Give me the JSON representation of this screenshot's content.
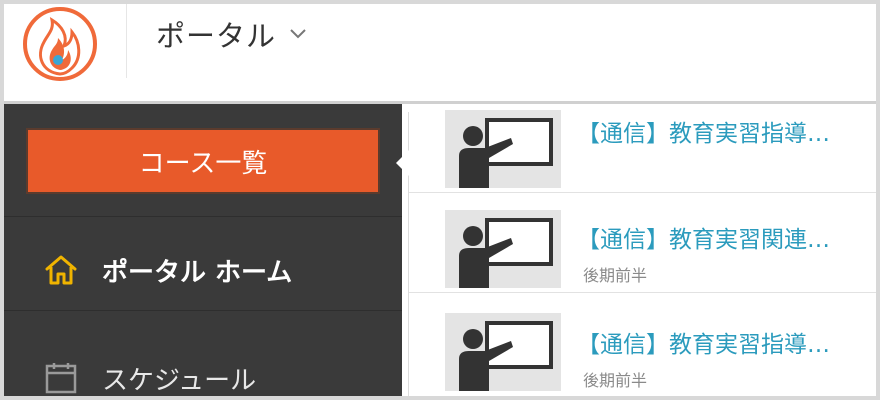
{
  "header": {
    "logo": "flame-logo",
    "portal_title": "ポータル",
    "dropdown_icon": "chevron-down-icon"
  },
  "sidebar": {
    "course_button_label": "コース一覧",
    "items": [
      {
        "label": "ポータル ホーム",
        "icon": "home-icon",
        "active": true
      },
      {
        "label": "スケジュール",
        "icon": "calendar-icon",
        "active": false
      }
    ]
  },
  "courses": [
    {
      "title": "【通信】教育実習指導…",
      "term": ""
    },
    {
      "title": "【通信】教育実習関連…",
      "term": "後期前半"
    },
    {
      "title": "【通信】教育実習指導…",
      "term": "後期前半"
    }
  ],
  "colors": {
    "accent": "#e85a2a",
    "sidebar_bg": "#3a3a3a",
    "link": "#2b9bbd",
    "home_icon": "#f0b400"
  }
}
